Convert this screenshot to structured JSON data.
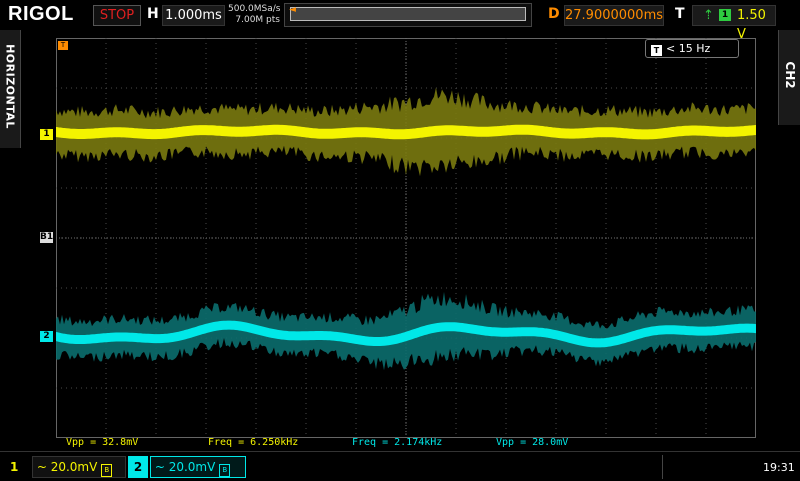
{
  "topbar": {
    "logo": "RIGOL",
    "run_status": "STOP",
    "horizontal_label": "H",
    "timebase": "1.000ms",
    "sample_rate": "500.0MSa/s",
    "memory_depth": "7.00M pts",
    "delay_label": "D",
    "delay": "27.9000000ms",
    "trigger_label": "T",
    "trigger_source": "1",
    "trigger_level": "1.50 V"
  },
  "side": {
    "left_tab": "HORIZONTAL",
    "right_tab": "CH2"
  },
  "screen": {
    "filter_badge": "< 15 Hz",
    "ch1_marker": "1",
    "ch2_marker": "2",
    "bus_marker": "B1"
  },
  "measurements": [
    "Vpp = 32.8mV",
    "Freq = 6.250kHz",
    "Freq = 2.174kHz",
    "Vpp = 28.0mV"
  ],
  "channels": [
    {
      "number": "1",
      "scale": "~ 20.0mV",
      "bw": "B",
      "color": "#f4f400"
    },
    {
      "number": "2",
      "scale": "~ 20.0mV",
      "bw": "B",
      "color": "#00e8e8"
    }
  ],
  "clock": "19:31",
  "colors": {
    "ch1": "#f4f400",
    "ch1_noise": "#7a7a10",
    "ch2": "#00e8e8",
    "ch2_noise": "#0b6e6e",
    "trigger": "#ff8c00",
    "stop": "#e02020"
  }
}
